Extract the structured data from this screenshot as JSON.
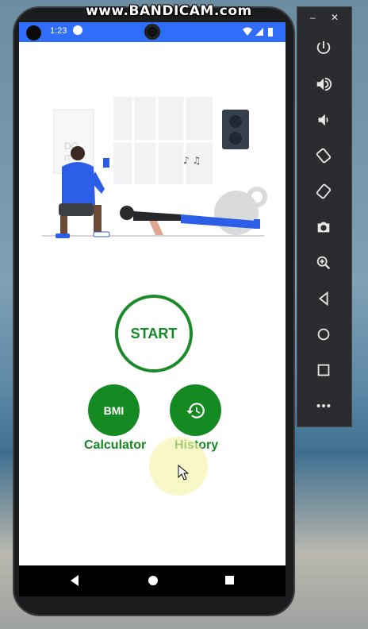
{
  "watermark": "www.BANDICAM.com",
  "status": {
    "time": "1:23"
  },
  "home": {
    "start_label": "START",
    "bmi_button_label": "BMI",
    "bmi_caption": "Calculator",
    "history_caption": "History"
  },
  "emulator": {
    "minimize_label": "–",
    "close_label": "✕",
    "controls": [
      "power-icon",
      "volume-up-icon",
      "volume-down-icon",
      "rotate-left-icon",
      "rotate-right-icon",
      "camera-icon",
      "zoom-icon",
      "back-icon",
      "home-icon",
      "overview-icon",
      "more-icon"
    ]
  },
  "colors": {
    "accent_green": "#168a22",
    "status_bar_blue": "#2f6dfa",
    "hero_blue": "#2c5ee8"
  }
}
